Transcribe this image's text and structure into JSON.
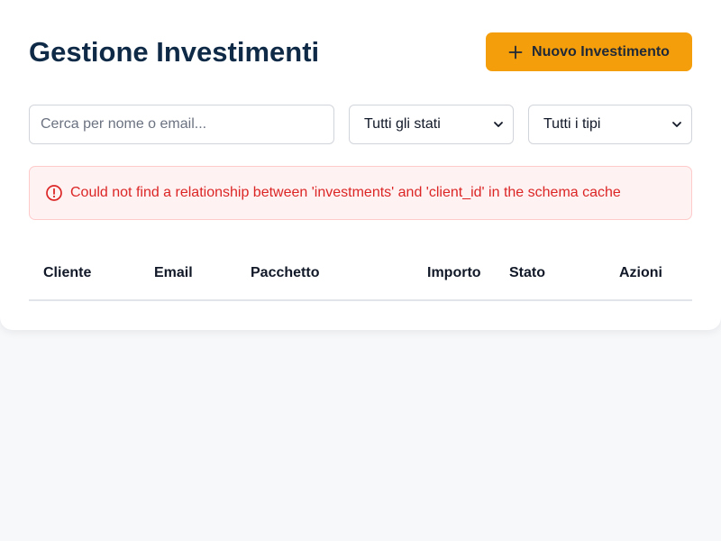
{
  "header": {
    "title": "Gestione Investimenti",
    "new_button_label": "Nuovo Investimento",
    "new_button_icon": "plus-icon"
  },
  "filters": {
    "search": {
      "placeholder": "Cerca per nome o email...",
      "value": ""
    },
    "status_select": {
      "selected": "Tutti gli stati"
    },
    "type_select": {
      "selected": "Tutti i tipi"
    }
  },
  "error": {
    "icon": "alert-circle-icon",
    "message": "Could not find a relationship between 'investments' and 'client_id' in the schema cache"
  },
  "table": {
    "columns": [
      "Cliente",
      "Email",
      "Pacchetto",
      "Importo",
      "Stato",
      "Azioni"
    ],
    "rows": []
  },
  "colors": {
    "accent": "#f59e0b",
    "title": "#0f2a47",
    "error_text": "#dc2626",
    "error_bg": "#fef2f2",
    "background": "#f7f8fa"
  }
}
